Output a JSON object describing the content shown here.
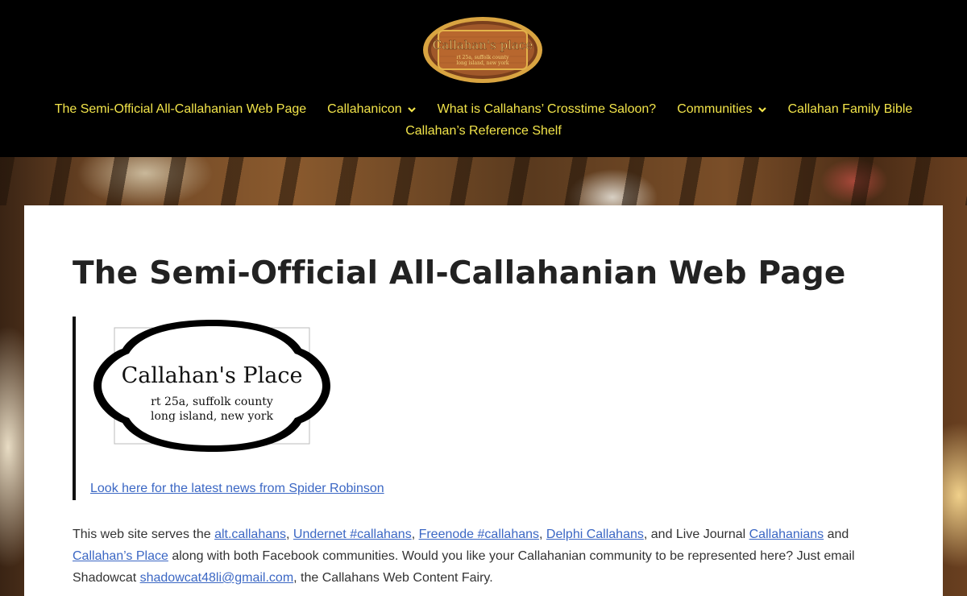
{
  "header": {
    "logo_text": "Callahan's Place"
  },
  "nav": {
    "row1": [
      {
        "label": "The Semi-Official All-Callahanian Web Page",
        "has_dropdown": false
      },
      {
        "label": "Callahanicon",
        "has_dropdown": true
      },
      {
        "label": "What is Callahans’ Crosstime Saloon?",
        "has_dropdown": false
      },
      {
        "label": "Communities",
        "has_dropdown": true
      },
      {
        "label": "Callahan Family Bible",
        "has_dropdown": false
      }
    ],
    "row2": [
      {
        "label": "Callahan’s Reference Shelf",
        "has_dropdown": false
      }
    ]
  },
  "main": {
    "title": "The Semi-Official All-Callahanian Web Page",
    "place_logo": {
      "name": "Callahan's Place",
      "line1": "rt 25a, suffolk county",
      "line2": "long island, new york"
    },
    "news_link": "Look here for the latest news from Spider Robinson",
    "paragraph": {
      "t1": "This web site serves the ",
      "l1": "alt.callahans",
      "t2": ", ",
      "l2": "Undernet #callahans",
      "t3": ", ",
      "l3": "Freenode #callahans",
      "t4": ", ",
      "l4": "Delphi Callahans",
      "t5": ", and Live Journal ",
      "l5": "Callahanians",
      "t6": " and ",
      "l6": "Callahan’s Place",
      "t7": " along with both Facebook communities. Would you like your Callahanian community to be represented here? Just email Shadowcat ",
      "l7": "shadowcat48li@gmail.com",
      "t8": ", the Callahans Web Content Fairy."
    }
  },
  "colors": {
    "nav_text": "#f2e44a",
    "link": "#3b67c4",
    "header_bg": "#000000"
  }
}
